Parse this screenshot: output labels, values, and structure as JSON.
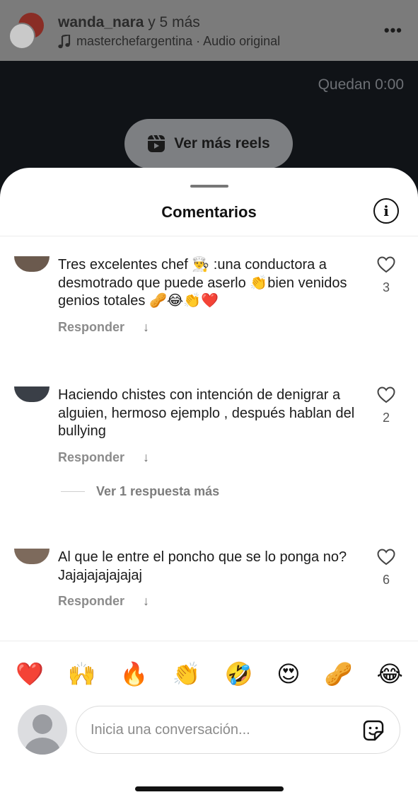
{
  "header": {
    "owner": "wanda_nara",
    "owner_rest": " y 5 más",
    "audio_account": "masterchefargentina",
    "audio_label": " · Audio original",
    "more": "•••"
  },
  "video": {
    "remaining": "Quedan 0:00",
    "reels_button": "Ver más reels",
    "reels_icon": "reels-icon"
  },
  "sheet": {
    "title": "Comentarios",
    "info_icon": "i"
  },
  "comments": [
    {
      "text": "Tres excelentes chef 👨‍🍳 :una conductora a desmotrado que puede aserlo 👏bien venidos genios totales 🥜😂👏❤️",
      "likes": "3",
      "reply": "Responder",
      "avatar_color": "#6b5a4e"
    },
    {
      "text": "Haciendo chistes con intención de denigrar a alguien, hermoso ejemplo , después hablan del bullying",
      "likes": "2",
      "reply": "Responder",
      "avatar_color": "#3a3f47"
    },
    {
      "text": "Al que le entre el poncho que se lo ponga no? Jajajajajajajaj",
      "likes": "6",
      "reply": "Responder",
      "avatar_color": "#7d6a5c"
    }
  ],
  "more_replies": "Ver 1 respuesta más",
  "emoji_bar": [
    "❤️",
    "🙌",
    "🔥",
    "👏",
    "🤣",
    "😍",
    "🥜",
    "😂"
  ],
  "composer": {
    "placeholder": "Inicia una conversación...",
    "sticker_icon": "sticker-icon"
  },
  "colors": {
    "dim_overlay": "#7b7b7b",
    "video_bg": "#101317",
    "muted_text": "#8b8b8b"
  }
}
